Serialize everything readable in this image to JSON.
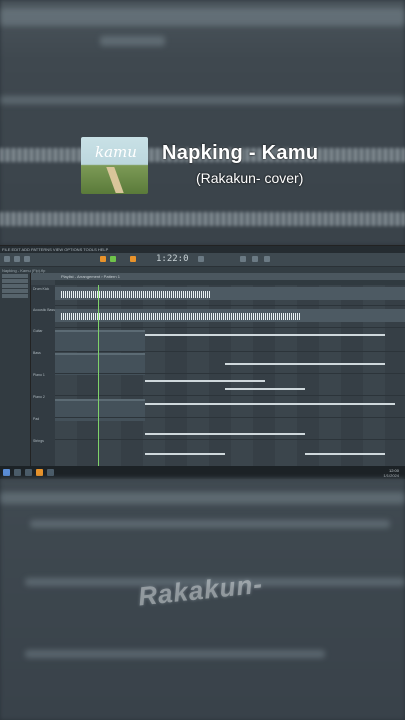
{
  "overlay": {
    "song_title": "Napking - Kamu",
    "song_subtitle": "(Rakakun- cover)",
    "cover_art_text": "kamu",
    "watermark": "Rakakun-"
  },
  "daw": {
    "menubar": "FILE EDIT ADD PATTERNS VIEW OPTIONS TOOLS HELP",
    "time": "1:22:0",
    "hint": "Napking - Kamu (Flp).flp",
    "playlist_title": "Playlist - Arrangement › Pattern 1",
    "tracks": [
      {
        "name": "Drum Kick",
        "type": "audio"
      },
      {
        "name": "Acoustic Bass",
        "type": "audio"
      },
      {
        "name": "Guitar",
        "type": "notes"
      },
      {
        "name": "Bass",
        "type": "notes"
      },
      {
        "name": "Piano 1",
        "type": "notes"
      },
      {
        "name": "Piano 2",
        "type": "notes"
      },
      {
        "name": "Pad",
        "type": "notes"
      },
      {
        "name": "Strings",
        "type": "notes"
      }
    ]
  },
  "taskbar": {
    "clock": "12:00",
    "date": "1/1/2024"
  },
  "colors": {
    "accent_orange": "#e8932b",
    "accent_green": "#6fc34a",
    "playhead": "#7fd36a"
  }
}
